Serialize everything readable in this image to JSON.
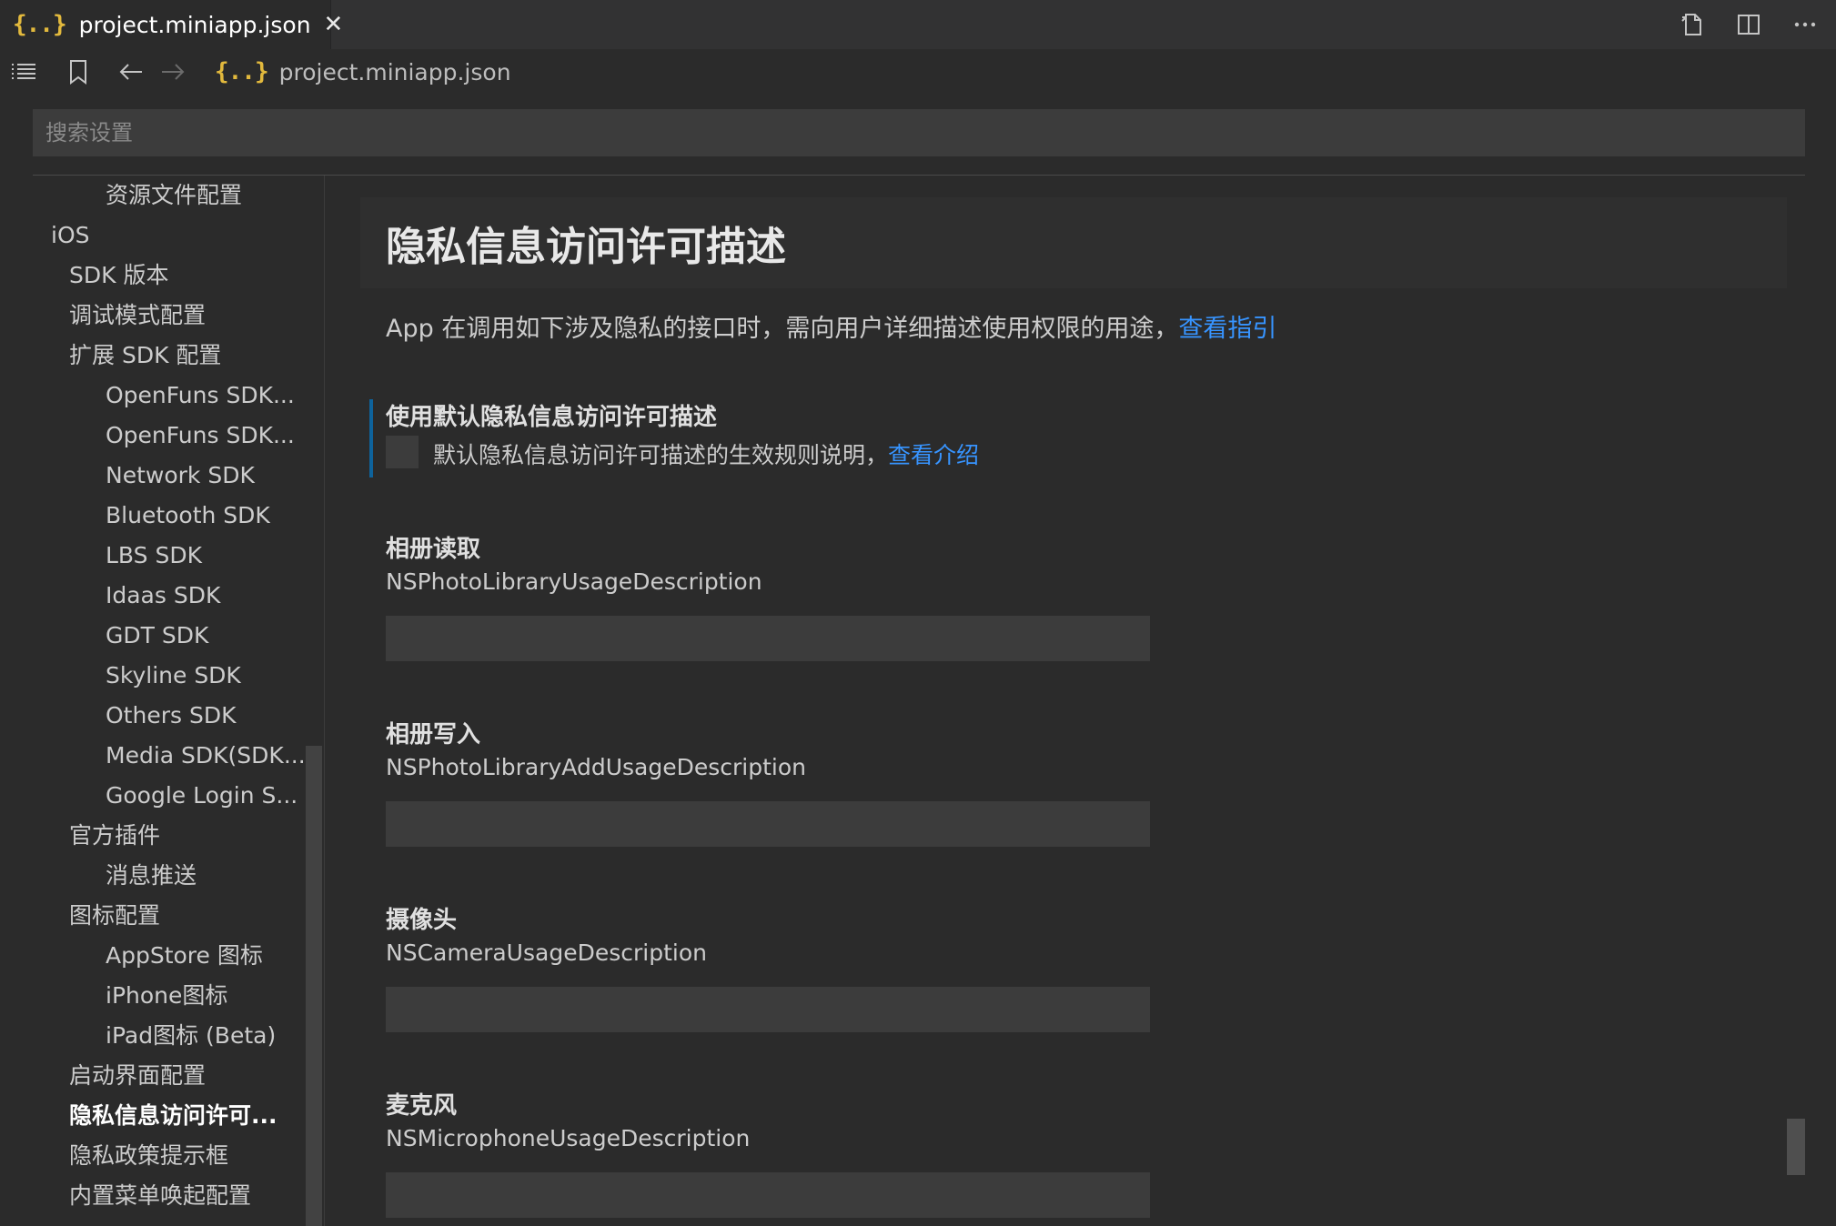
{
  "tab": {
    "icon": "json-braces-icon",
    "title": "project.miniapp.json",
    "close": "✕"
  },
  "tab_actions": [
    {
      "name": "open-changes-icon"
    },
    {
      "name": "split-editor-icon"
    },
    {
      "name": "more-actions-icon"
    }
  ],
  "breadcrumb": {
    "file": "project.miniapp.json"
  },
  "search": {
    "placeholder": "搜索设置"
  },
  "sidebar": {
    "items": [
      {
        "label": "资源文件配置",
        "level": 2
      },
      {
        "label": "iOS",
        "level": 0
      },
      {
        "label": "SDK 版本",
        "level": 1
      },
      {
        "label": "调试模式配置",
        "level": 1
      },
      {
        "label": "扩展 SDK 配置",
        "level": 1
      },
      {
        "label": "OpenFuns SDK...",
        "level": 2
      },
      {
        "label": "OpenFuns SDK...",
        "level": 2
      },
      {
        "label": "Network SDK",
        "level": 2
      },
      {
        "label": "Bluetooth SDK",
        "level": 2
      },
      {
        "label": "LBS SDK",
        "level": 2
      },
      {
        "label": "Idaas SDK",
        "level": 2
      },
      {
        "label": "GDT SDK",
        "level": 2
      },
      {
        "label": "Skyline SDK",
        "level": 2
      },
      {
        "label": "Others SDK",
        "level": 2
      },
      {
        "label": "Media SDK(SDK...",
        "level": 2
      },
      {
        "label": "Google Login S...",
        "level": 2
      },
      {
        "label": "官方插件",
        "level": 1
      },
      {
        "label": "消息推送",
        "level": 2
      },
      {
        "label": "图标配置",
        "level": 1
      },
      {
        "label": "AppStore 图标",
        "level": 2
      },
      {
        "label": "iPhone图标",
        "level": 2
      },
      {
        "label": "iPad图标 (Beta)",
        "level": 2
      },
      {
        "label": "启动界面配置",
        "level": 1
      },
      {
        "label": "隐私信息访问许可...",
        "level": 1,
        "active": true
      },
      {
        "label": "隐私政策提示框",
        "level": 1
      },
      {
        "label": "内置菜单唤起配置",
        "level": 1
      }
    ]
  },
  "main": {
    "section_title": "隐私信息访问许可描述",
    "intro_text": "App 在调用如下涉及隐私的接口时，需向用户详细描述使用权限的用途，",
    "intro_link": "查看指引",
    "default_setting": {
      "label": "使用默认隐私信息访问许可描述",
      "checked": false,
      "description": "默认隐私信息访问许可描述的生效规则说明，",
      "link": "查看介绍"
    },
    "fields": [
      {
        "label": "相册读取",
        "key": "NSPhotoLibraryUsageDescription",
        "value": ""
      },
      {
        "label": "相册写入",
        "key": "NSPhotoLibraryAddUsageDescription",
        "value": ""
      },
      {
        "label": "摄像头",
        "key": "NSCameraUsageDescription",
        "value": ""
      },
      {
        "label": "麦克风",
        "key": "NSMicrophoneUsageDescription",
        "value": ""
      }
    ]
  },
  "colors": {
    "accent_link": "#3794ff",
    "json_icon": "#e2b93d",
    "background": "#2b2b2b"
  }
}
